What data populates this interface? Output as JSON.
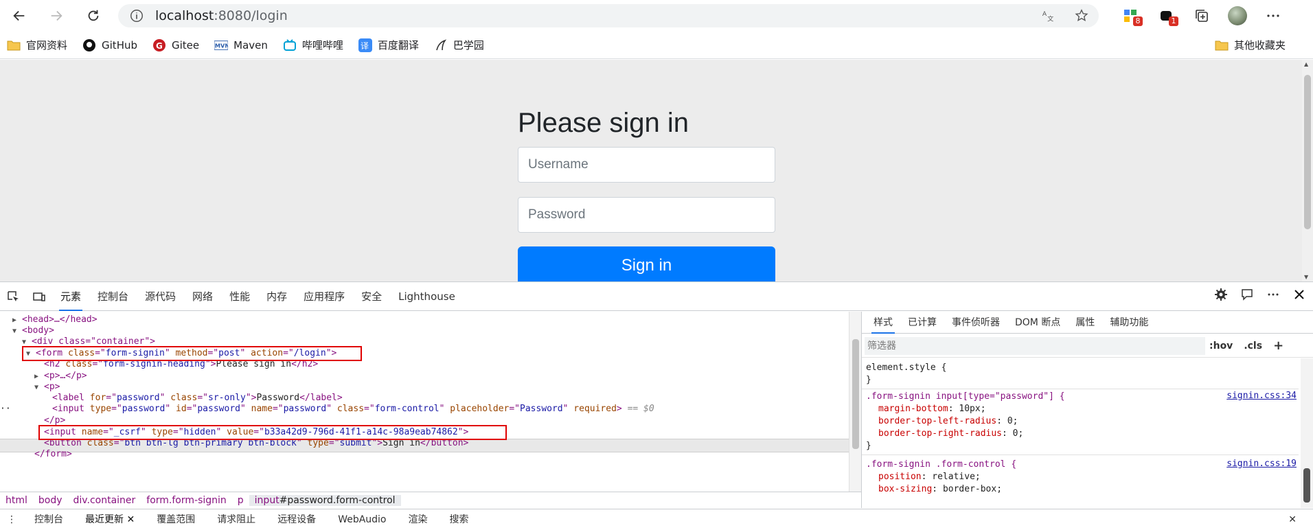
{
  "browser": {
    "url_host": "localhost",
    "url_rest": ":8080/login",
    "profile_badges": [
      "8",
      "1"
    ]
  },
  "bookmarks": [
    {
      "label": "官网资料",
      "icon": "folder-icon"
    },
    {
      "label": "GitHub",
      "icon": "github-icon"
    },
    {
      "label": "Gitee",
      "icon": "gitee-icon"
    },
    {
      "label": "Maven",
      "icon": "maven-icon"
    },
    {
      "label": "哔哩哔哩",
      "icon": "bilibili-icon"
    },
    {
      "label": "百度翻译",
      "icon": "baidu-translate-icon"
    },
    {
      "label": "巴学园",
      "icon": "bxy-icon"
    }
  ],
  "bookmarks_other": "其他收藏夹",
  "page": {
    "title": "Please sign in",
    "username_placeholder": "Username",
    "password_placeholder": "Password",
    "submit_label": "Sign in"
  },
  "devtools": {
    "tabs": [
      "元素",
      "控制台",
      "源代码",
      "网络",
      "性能",
      "内存",
      "应用程序",
      "安全",
      "Lighthouse"
    ],
    "active_tab": "元素",
    "dom": {
      "head": "<head>…</head>",
      "body": "<body>",
      "div_open": "<div class=\"container\">",
      "form_tag": "form",
      "form_class": "form-signin",
      "form_method": "post",
      "form_action": "/login",
      "h2_class": "form-signin-heading",
      "h2_text": "Please sign in",
      "p_collapsed": "<p>…</p>",
      "p_open": "<p>",
      "label_for": "password",
      "label_class": "sr-only",
      "label_text": "Password",
      "input_type": "password",
      "input_id": "password",
      "input_name": "password",
      "input_class": "form-control",
      "input_placeholder": "Password",
      "input_required": "required",
      "eq0": "== $0",
      "p_close": "</p>",
      "csrf_name": "_csrf",
      "csrf_type": "hidden",
      "csrf_value": "b33a42d9-796d-41f1-a14c-98a9eab74862",
      "button_class": "btn btn-lg btn-primary btn-block",
      "button_type": "submit",
      "button_text": "Sign in",
      "form_close": "</form>"
    },
    "breadcrumb": [
      "html",
      "body",
      "div.container",
      "form.form-signin",
      "p"
    ],
    "breadcrumb_active_tag": "input",
    "breadcrumb_active_rest": "#password.form-control",
    "styles_tabs": [
      "样式",
      "已计算",
      "事件侦听器",
      "DOM 断点",
      "属性",
      "辅助功能"
    ],
    "filter_placeholder": "筛选器",
    "filter_hov": ":hov",
    "filter_cls": ".cls",
    "rules": {
      "element_style": "element.style {",
      "close": "}",
      "r1_selector": ".form-signin input[type=\"password\"] {",
      "r1_source": "signin.css:34",
      "r1_props": [
        {
          "name": "margin-bottom",
          "value": "10px;"
        },
        {
          "name": "border-top-left-radius",
          "value": "0;"
        },
        {
          "name": "border-top-right-radius",
          "value": "0;"
        }
      ],
      "r2_selector": ".form-signin .form-control {",
      "r2_source": "signin.css:19",
      "r2_props": [
        {
          "name": "position",
          "value": "relative;"
        },
        {
          "name": "box-sizing",
          "value": "border-box;"
        }
      ]
    },
    "drawer_tabs": [
      "控制台",
      "最近更新",
      "覆盖范围",
      "请求阻止",
      "远程设备",
      "WebAudio",
      "渲染",
      "搜索"
    ],
    "drawer_active": "最近更新"
  }
}
